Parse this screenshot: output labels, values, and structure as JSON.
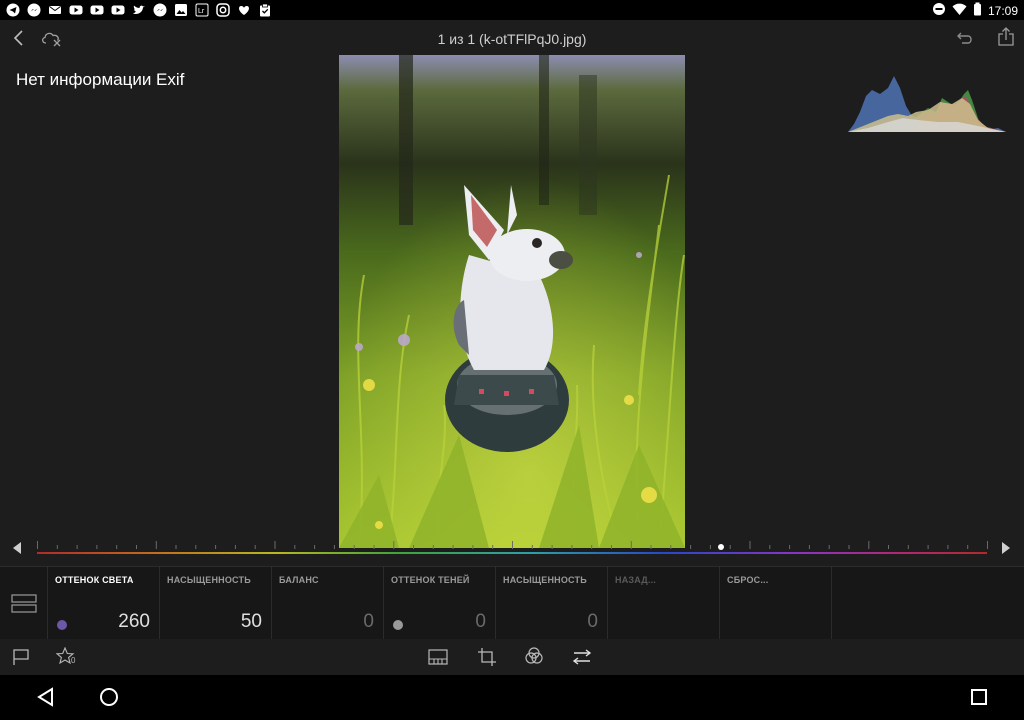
{
  "status_bar": {
    "time": "17:09",
    "notification_icons": [
      "telegram-icon",
      "messenger-icon",
      "gmail-icon",
      "youtube-icon",
      "youtube-icon",
      "youtube-icon",
      "twitter-icon",
      "messenger-icon",
      "photos-icon",
      "lightroom-icon",
      "instagram-icon",
      "heart-icon",
      "clipboard-icon"
    ]
  },
  "header": {
    "title": "1 из 1 (k-otTFlPqJ0.jpg)"
  },
  "info": {
    "exif_text": "Нет информации Exif"
  },
  "hue_slider": {
    "value_fraction": 0.72
  },
  "params": [
    {
      "label": "ОТТЕНОК СВЕТА",
      "value": "260",
      "dot_color": "#6b58a6",
      "active": true
    },
    {
      "label": "НАСЫЩЕННОСТЬ",
      "value": "50"
    },
    {
      "label": "БАЛАНС",
      "value": "0"
    },
    {
      "label": "ОТТЕНОК ТЕНЕЙ",
      "value": "0",
      "dot_color": "#9a9a9a"
    },
    {
      "label": "НАСЫЩЕННОСТЬ",
      "value": "0"
    },
    {
      "label": "НАЗАД...",
      "value": ""
    },
    {
      "label": "СБРОС...",
      "value": ""
    }
  ],
  "toolbar": {
    "rating_count": "0"
  },
  "colors": {
    "background": "#1d1d1d",
    "panel": "#171717",
    "accent_dot": "#6b58a6"
  }
}
